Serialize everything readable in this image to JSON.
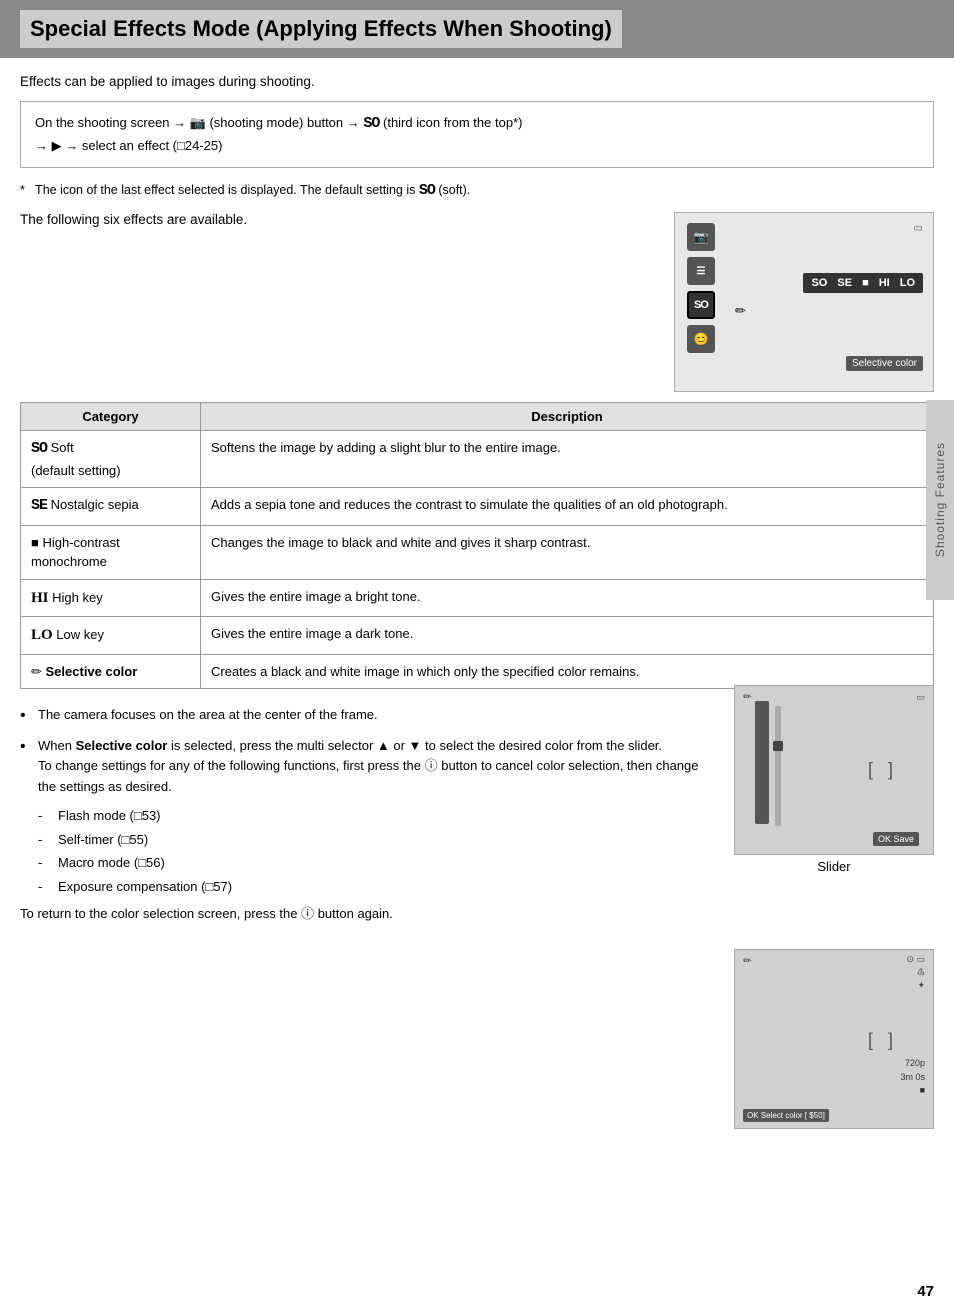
{
  "header": {
    "title": "Special Effects Mode (Applying Effects When Shooting)"
  },
  "intro": "Effects can be applied to images during shooting.",
  "instruction": {
    "line1": "On the shooting screen → 📷 (shooting mode) button → SO (third icon from the top*)",
    "line2": "→ ▶ → select an effect (□24-25)"
  },
  "footnote": "*   The icon of the last effect selected is displayed. The default setting is SO (soft).",
  "six_effects": "The following six effects are available.",
  "table": {
    "headers": [
      "Category",
      "Description"
    ],
    "rows": [
      {
        "category_symbol": "SO",
        "category_name": "Soft\n(default setting)",
        "description": "Softens the image by adding a slight blur to the entire image."
      },
      {
        "category_symbol": "SE",
        "category_name": "Nostalgic sepia",
        "description": "Adds a sepia tone and reduces the contrast to simulate the qualities of an old photograph."
      },
      {
        "category_symbol": "■",
        "category_name": "High-contrast\nmonochrome",
        "description": "Changes the image to black and white and gives it sharp contrast."
      },
      {
        "category_symbol": "HI",
        "category_name": "High key",
        "description": "Gives the entire image a bright tone."
      },
      {
        "category_symbol": "LO",
        "category_name": "Low key",
        "description": "Gives the entire image a dark tone."
      },
      {
        "category_symbol": "✏",
        "category_name": "Selective color",
        "description": "Creates a black and white image in which only the specified color remains."
      }
    ]
  },
  "bullets": [
    {
      "text": "The camera focuses on the area at the center of the frame.",
      "bold_part": ""
    },
    {
      "text_start": "When ",
      "bold_part": "Selective color",
      "text_end": " is selected, press the multi selector ▲ or ▼ to select the desired color from the slider.\nTo change settings for any of the following functions, first press the ⓪ button to cancel color selection, then change the settings as desired."
    }
  ],
  "sub_bullets": [
    "Flash mode (□53)",
    "Self-timer (□55)",
    "Macro mode (□56)",
    "Exposure compensation (□57)"
  ],
  "continue_text": "To return to the color selection screen, press the ⓪ button again.",
  "slider_label": "Slider",
  "camera_screen": {
    "effects_badges": [
      "SO",
      "SE",
      "■",
      "HI",
      "LO"
    ],
    "selective_color": "Selective color"
  },
  "page_number": "47",
  "side_tab": "Shooting Features"
}
